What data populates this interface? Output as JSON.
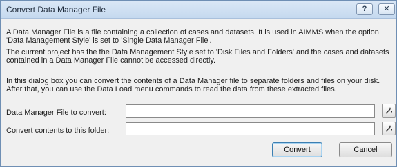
{
  "window": {
    "title": "Convert Data Manager File",
    "help_glyph": "?",
    "close_glyph": "✕"
  },
  "body": {
    "paragraph1": "A Data Manager File is a file containing a collection of cases and datasets. It is used in AIMMS when the option 'Data Management Style' is set to 'Single Data Manager File'.",
    "paragraph2": "The current project has the the Data Management Style set to 'Disk Files and Folders' and the cases and datasets contained in a Data Manager File cannot be accessed directly.",
    "paragraph3": "In this dialog box you can convert the contents of a Data Manager file to separate folders and files on your disk. After that, you can use the Data Load menu commands to read the data from these extracted files."
  },
  "fields": {
    "file_label": "Data Manager File to convert:",
    "file_value": "",
    "folder_label": "Convert contents to this folder:",
    "folder_value": ""
  },
  "buttons": {
    "convert": "Convert",
    "cancel": "Cancel"
  },
  "icons": {
    "browse": "wand-icon"
  }
}
